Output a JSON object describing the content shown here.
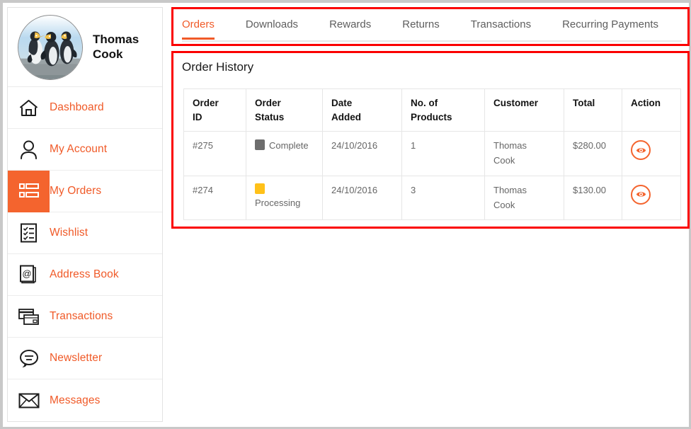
{
  "profile": {
    "name": "Thomas Cook",
    "avatar_alt": "penguins-photo"
  },
  "sidebar": {
    "items": [
      {
        "label": "Dashboard",
        "icon": "home-icon",
        "active": false
      },
      {
        "label": "My Account",
        "icon": "user-icon",
        "active": false
      },
      {
        "label": "My Orders",
        "icon": "orders-list-icon",
        "active": true
      },
      {
        "label": "Wishlist",
        "icon": "checklist-icon",
        "active": false
      },
      {
        "label": "Address Book",
        "icon": "address-book-icon",
        "active": false
      },
      {
        "label": "Transactions",
        "icon": "credit-cards-icon",
        "active": false
      },
      {
        "label": "Newsletter",
        "icon": "speech-bubble-icon",
        "active": false
      },
      {
        "label": "Messages",
        "icon": "envelope-icon",
        "active": false
      }
    ]
  },
  "tabs": [
    {
      "label": "Orders",
      "active": true
    },
    {
      "label": "Downloads",
      "active": false
    },
    {
      "label": "Rewards",
      "active": false
    },
    {
      "label": "Returns",
      "active": false
    },
    {
      "label": "Transactions",
      "active": false
    },
    {
      "label": "Recurring Payments",
      "active": false
    }
  ],
  "panel": {
    "title": "Order History"
  },
  "table": {
    "headers": [
      {
        "line1": "Order",
        "line2": "ID"
      },
      {
        "line1": "Order",
        "line2": "Status"
      },
      {
        "line1": "Date",
        "line2": "Added"
      },
      {
        "line1": "No. of",
        "line2": "Products"
      },
      {
        "line1": "Customer",
        "line2": ""
      },
      {
        "line1": "Total",
        "line2": ""
      },
      {
        "line1": "Action",
        "line2": ""
      }
    ],
    "rows": [
      {
        "order_id": "#275",
        "status": "Complete",
        "status_color": "#6d6d6d",
        "status_wrapped": false,
        "date_added": "24/10/2016",
        "no_of_products": "1",
        "customer_first": "Thomas",
        "customer_last": "Cook",
        "total": "$280.00",
        "action_icon": "eye-icon"
      },
      {
        "order_id": "#274",
        "status": "Processing",
        "status_color": "#ffc119",
        "status_wrapped": true,
        "date_added": "24/10/2016",
        "no_of_products": "3",
        "customer_first": "Thomas",
        "customer_last": "Cook",
        "total": "$130.00",
        "action_icon": "eye-icon"
      }
    ]
  },
  "colors": {
    "accent": "#f05a28",
    "accent_block": "#f4642e",
    "annotation": "#fb0000",
    "status_complete": "#6d6d6d",
    "status_processing": "#ffc119",
    "text_muted": "#666666"
  }
}
